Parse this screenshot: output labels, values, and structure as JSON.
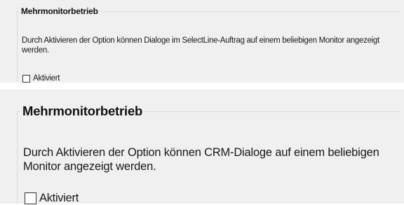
{
  "dialog_small": {
    "group_title": "Mehrmonitorbetrieb",
    "description": "Durch Aktivieren der Option können Dialoge im SelectLine-Auftrag auf einem beliebigen Monitor angezeigt werden.",
    "checkbox": {
      "label": "Aktiviert",
      "checked": false
    }
  },
  "dialog_large": {
    "group_title": "Mehrmonitorbetrieb",
    "description": "Durch Aktivieren der Option können CRM-Dialoge auf einem beliebigen Monitor angezeigt werden.",
    "checkbox": {
      "label": "Aktiviert",
      "checked": false
    }
  }
}
